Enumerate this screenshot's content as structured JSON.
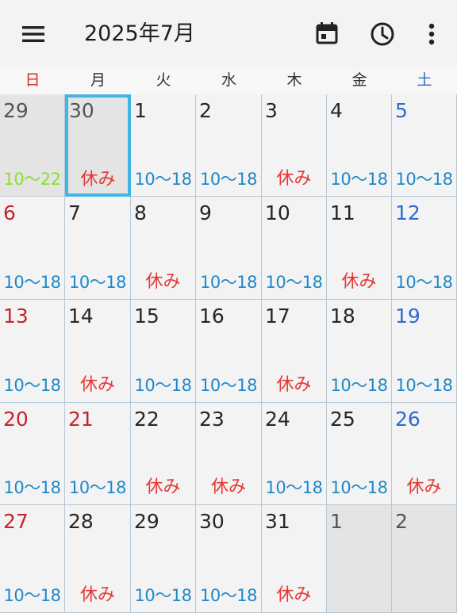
{
  "appbar": {
    "title": "2025年7月",
    "menu_icon": "hamburger-menu-icon",
    "actions": [
      {
        "icon": "calendar-today-icon"
      },
      {
        "icon": "clock-icon"
      },
      {
        "icon": "more-vert-icon"
      }
    ]
  },
  "weekdays": [
    "日",
    "月",
    "火",
    "水",
    "木",
    "金",
    "土"
  ],
  "colors": {
    "sunday": "#c8232c",
    "saturday": "#2f6bd0",
    "work_shift": "#1e88c8",
    "day_off": "#e53935",
    "long_shift": "#8be02a",
    "selected_border": "#40b5e6"
  },
  "weeks": [
    [
      {
        "day": "29",
        "shift": "10〜22",
        "kind": "long",
        "other": true
      },
      {
        "day": "30",
        "shift": "休み",
        "kind": "off",
        "other": true,
        "selected": true
      },
      {
        "day": "1",
        "shift": "10〜18",
        "kind": "work"
      },
      {
        "day": "2",
        "shift": "10〜18",
        "kind": "work"
      },
      {
        "day": "3",
        "shift": "休み",
        "kind": "off"
      },
      {
        "day": "4",
        "shift": "10〜18",
        "kind": "work"
      },
      {
        "day": "5",
        "shift": "10〜18",
        "kind": "work"
      }
    ],
    [
      {
        "day": "6",
        "shift": "10〜18",
        "kind": "work"
      },
      {
        "day": "7",
        "shift": "10〜18",
        "kind": "work"
      },
      {
        "day": "8",
        "shift": "休み",
        "kind": "off"
      },
      {
        "day": "9",
        "shift": "10〜18",
        "kind": "work"
      },
      {
        "day": "10",
        "shift": "10〜18",
        "kind": "work"
      },
      {
        "day": "11",
        "shift": "休み",
        "kind": "off"
      },
      {
        "day": "12",
        "shift": "10〜18",
        "kind": "work"
      }
    ],
    [
      {
        "day": "13",
        "shift": "10〜18",
        "kind": "work"
      },
      {
        "day": "14",
        "shift": "休み",
        "kind": "off"
      },
      {
        "day": "15",
        "shift": "10〜18",
        "kind": "work"
      },
      {
        "day": "16",
        "shift": "10〜18",
        "kind": "work"
      },
      {
        "day": "17",
        "shift": "休み",
        "kind": "off"
      },
      {
        "day": "18",
        "shift": "10〜18",
        "kind": "work"
      },
      {
        "day": "19",
        "shift": "10〜18",
        "kind": "work"
      }
    ],
    [
      {
        "day": "20",
        "shift": "10〜18",
        "kind": "work"
      },
      {
        "day": "21",
        "shift": "10〜18",
        "kind": "work",
        "holiday": true
      },
      {
        "day": "22",
        "shift": "休み",
        "kind": "off"
      },
      {
        "day": "23",
        "shift": "休み",
        "kind": "off"
      },
      {
        "day": "24",
        "shift": "10〜18",
        "kind": "work"
      },
      {
        "day": "25",
        "shift": "10〜18",
        "kind": "work"
      },
      {
        "day": "26",
        "shift": "休み",
        "kind": "off"
      }
    ],
    [
      {
        "day": "27",
        "shift": "10〜18",
        "kind": "work"
      },
      {
        "day": "28",
        "shift": "休み",
        "kind": "off"
      },
      {
        "day": "29",
        "shift": "10〜18",
        "kind": "work"
      },
      {
        "day": "30",
        "shift": "10〜18",
        "kind": "work"
      },
      {
        "day": "31",
        "shift": "休み",
        "kind": "off"
      },
      {
        "day": "1",
        "shift": "",
        "kind": "none",
        "other": true
      },
      {
        "day": "2",
        "shift": "",
        "kind": "none",
        "other": true
      }
    ]
  ]
}
